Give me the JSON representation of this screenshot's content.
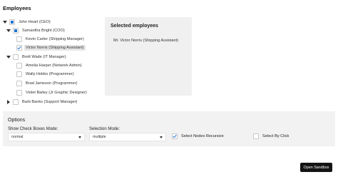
{
  "page": {
    "title": "Employees"
  },
  "tree": {
    "nodes": [
      {
        "label": "John Heart (CEO)",
        "state": "indeterminate",
        "expanded": true
      },
      {
        "label": "Samantha Bright (COO)",
        "state": "indeterminate",
        "expanded": true
      },
      {
        "label": "Kevin Carter (Shipping Manager)",
        "state": "unchecked"
      },
      {
        "label": "Victor Norris (Shipping Assistant)",
        "state": "checked",
        "highlighted": true
      },
      {
        "label": "Brett Wade (IT Manager)",
        "state": "unchecked",
        "expanded": true
      },
      {
        "label": "Amelia Harper (Network Admin)",
        "state": "unchecked"
      },
      {
        "label": "Wally Hobbs (Programmer)",
        "state": "unchecked"
      },
      {
        "label": "Brad Jameson (Programmer)",
        "state": "unchecked"
      },
      {
        "label": "Violet Bailey (Jr Graphic Designer)",
        "state": "unchecked"
      },
      {
        "label": "Barb Banks (Support Manager)",
        "state": "unchecked",
        "expanded": false
      }
    ]
  },
  "selected_panel": {
    "title": "Selected employees",
    "items": [
      "Mr. Victor Norris (Shipping Assistant)"
    ]
  },
  "options": {
    "title": "Options",
    "show_check_boxes": {
      "label": "Show Check Boxes Mode:",
      "value": "normal"
    },
    "selection_mode": {
      "label": "Selection Mode:",
      "value": "multiple"
    },
    "select_nodes_recursive": {
      "label": "Select Nodes Recursive",
      "checked": true
    },
    "select_by_click": {
      "label": "Select By Click",
      "checked": false
    }
  },
  "sandbox_button": {
    "label": "Open Sandbox"
  },
  "colors": {
    "accent": "#1e73d2",
    "button_bg": "#141414",
    "panel_bg": "#f0f0f0"
  }
}
